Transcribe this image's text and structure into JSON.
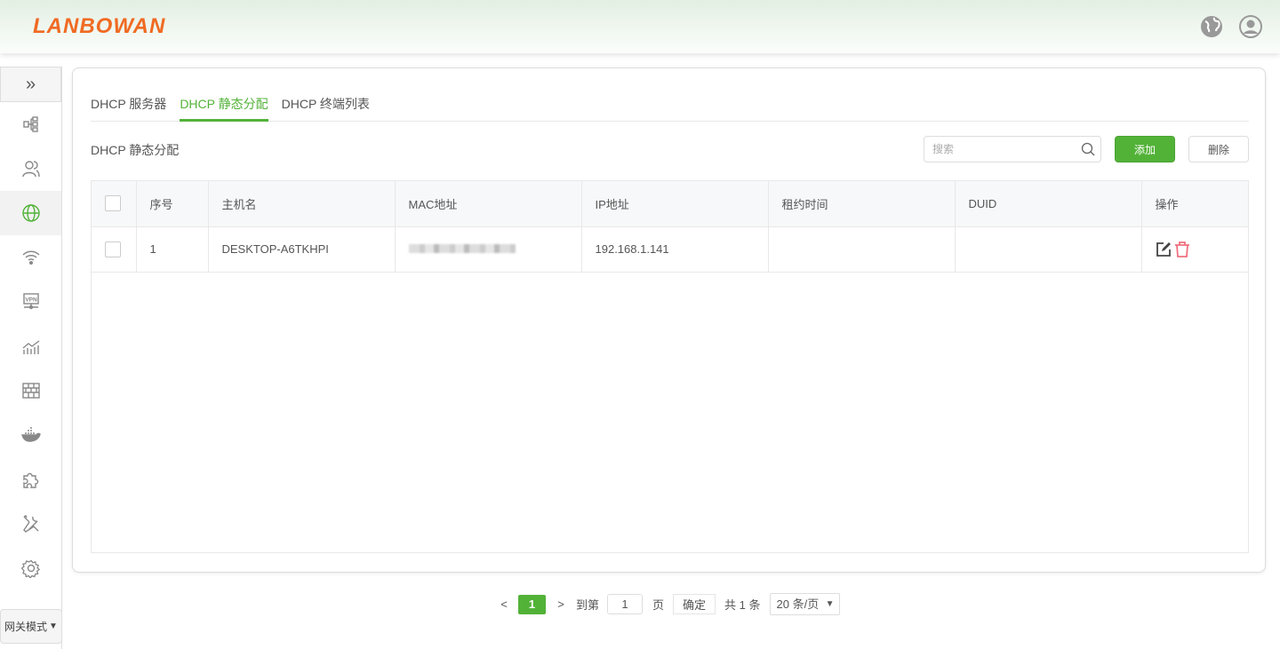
{
  "brand": {
    "logo": "LANBOWAN",
    "accent": "#52b238",
    "logo_color": "#f06a22"
  },
  "header": {
    "icons": [
      "globe-icon",
      "user-icon"
    ]
  },
  "sidebar": {
    "toggle": "»",
    "items": [
      {
        "icon": "topology-icon"
      },
      {
        "icon": "users-icon"
      },
      {
        "icon": "globe-icon",
        "active": true
      },
      {
        "icon": "wifi-icon"
      },
      {
        "icon": "vpn-icon"
      },
      {
        "icon": "chart-icon"
      },
      {
        "icon": "firewall-icon"
      },
      {
        "icon": "docker-icon"
      },
      {
        "icon": "plugin-icon"
      },
      {
        "icon": "tools-icon"
      },
      {
        "icon": "settings-icon"
      }
    ],
    "mode": "网关模式"
  },
  "tabs": [
    {
      "label": "DHCP 服务器"
    },
    {
      "label": "DHCP 静态分配",
      "active": true
    },
    {
      "label": "DHCP 终端列表"
    }
  ],
  "section_title": "DHCP 静态分配",
  "search": {
    "placeholder": "搜索"
  },
  "buttons": {
    "add": "添加",
    "delete": "删除"
  },
  "table": {
    "columns": [
      "序号",
      "主机名",
      "MAC地址",
      "IP地址",
      "租约时间",
      "DUID",
      "操作"
    ],
    "rows": [
      {
        "index": "1",
        "hostname": "DESKTOP-A6TKHPI",
        "ip": "192.168.1.141",
        "lease": "",
        "duid": ""
      }
    ]
  },
  "pagination": {
    "prev": "<",
    "current": "1",
    "next": ">",
    "goto_label": "到第",
    "goto_value": "1",
    "page_label": "页",
    "confirm": "确定",
    "total": "共 1 条",
    "page_size": "20 条/页"
  }
}
